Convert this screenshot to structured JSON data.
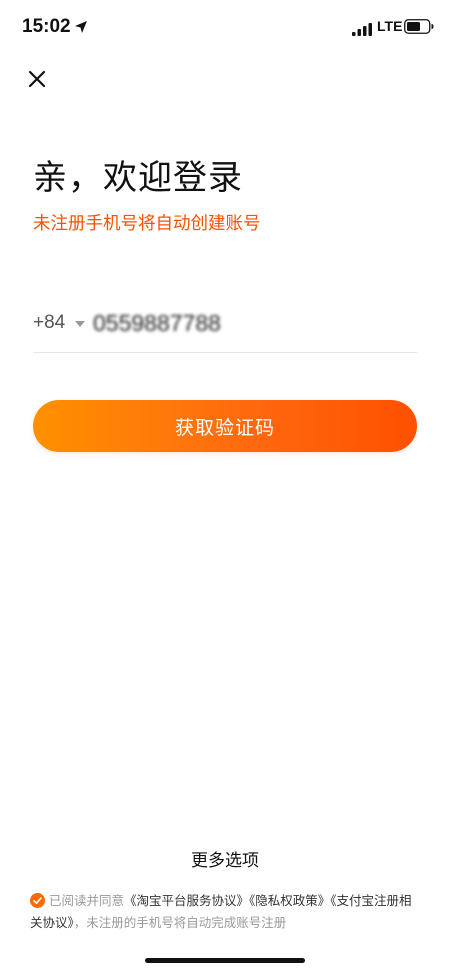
{
  "status_bar": {
    "time": "15:02",
    "network": "LTE"
  },
  "login": {
    "title": "亲，欢迎登录",
    "subtitle": "未注册手机号将自动创建账号",
    "country_code": "+84",
    "phone_value": "0559887788",
    "submit_label": "获取验证码"
  },
  "footer": {
    "more_options": "更多选项",
    "agreement_prefix": "已阅读并同意",
    "links": {
      "service": "《淘宝平台服务协议》",
      "privacy": "《隐私权政策》",
      "alipay": "《支付宝注册相关协议》"
    },
    "agreement_suffix": "，未注册的手机号将自动完成账号注册"
  },
  "colors": {
    "accent": "#ff5000",
    "gradient_start": "#ff9000",
    "gradient_end": "#ff5000"
  }
}
